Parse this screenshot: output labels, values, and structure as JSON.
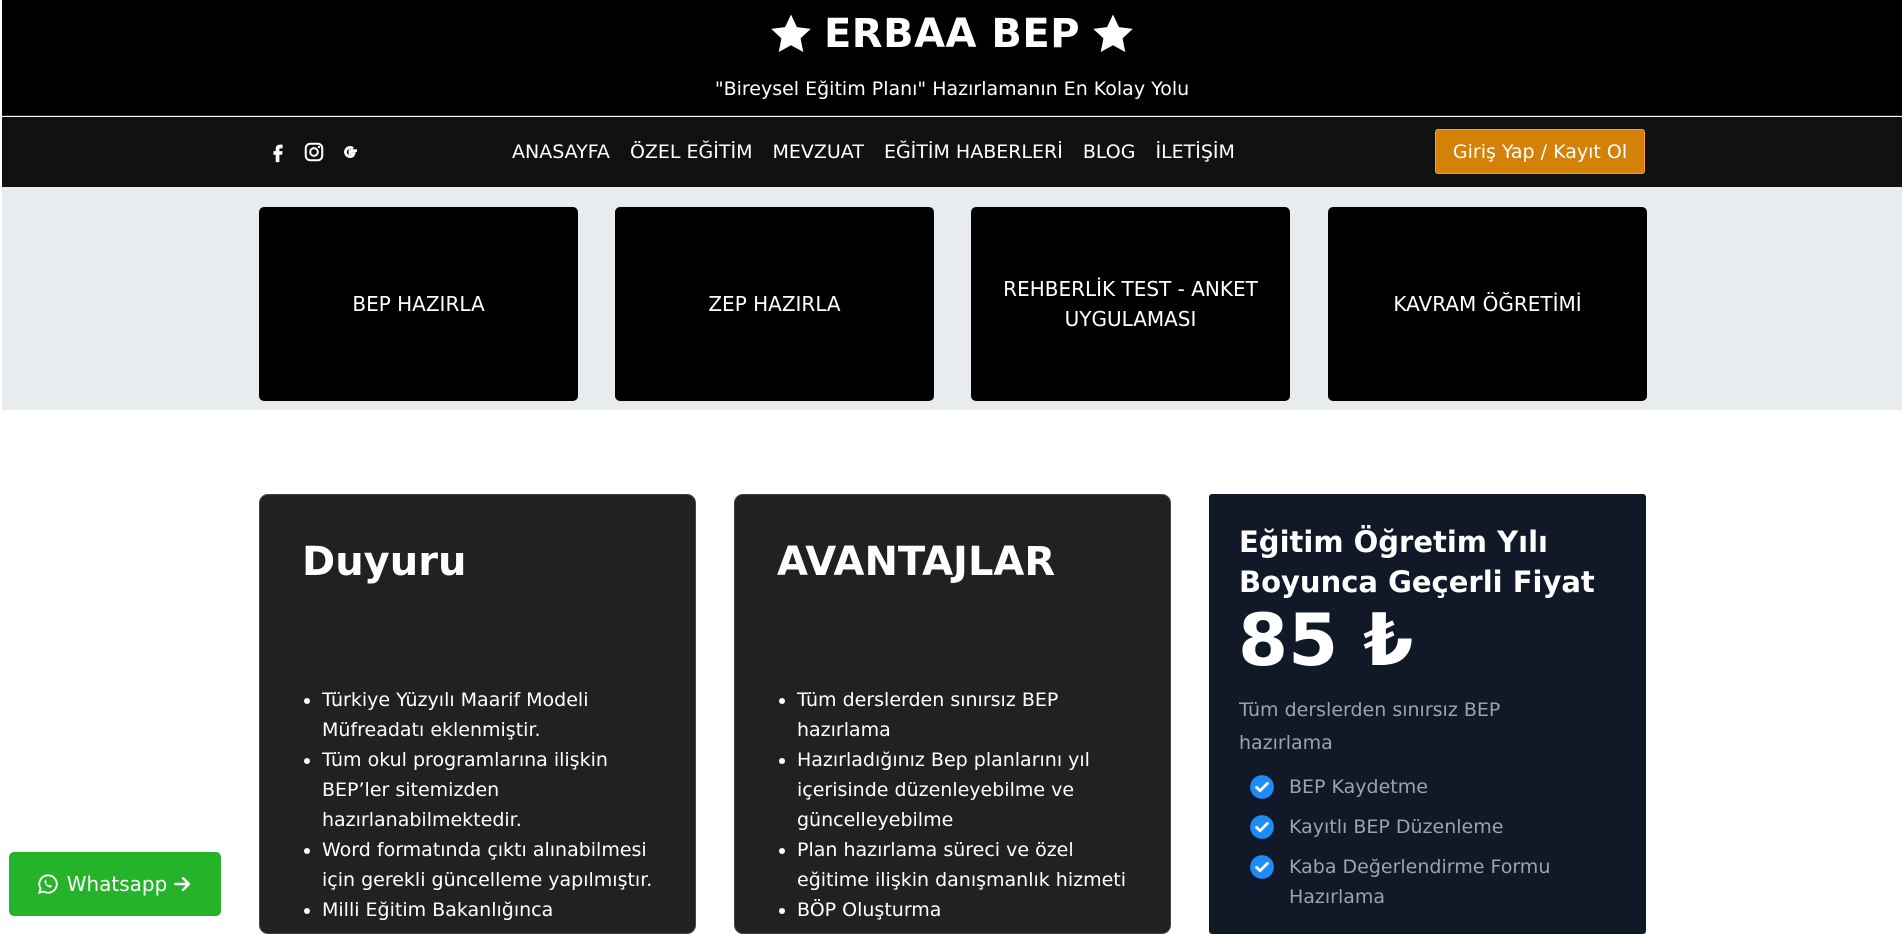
{
  "header": {
    "brand": "ERBAA BEP",
    "tagline": "\"Bireysel Eğitim Planı\" Hazırlamanın En Kolay Yolu"
  },
  "socials": [
    {
      "icon": "facebook-icon"
    },
    {
      "icon": "instagram-icon"
    },
    {
      "icon": "google-icon"
    }
  ],
  "nav": {
    "links": [
      "ANASAYFA",
      "ÖZEL EĞİTİM",
      "MEVZUAT",
      "EĞİTİM HABERLERİ",
      "BLOG",
      "İLETİŞİM"
    ],
    "login_label": "Giriş Yap / Kayıt Ol"
  },
  "tiles": [
    "BEP HAZIRLA",
    "ZEP HAZIRLA",
    "REHBERLİK TEST - ANKET UYGULAMASI",
    "KAVRAM ÖĞRETİMİ"
  ],
  "announcement": {
    "title": "Duyuru",
    "items": [
      "Türkiye Yüzyılı Maarif Modeli Müfreadatı eklenmiştir.",
      "Tüm okul programlarına ilişkin BEP’ler sitemizden hazırlanabilmektedir.",
      "Word formatında çıktı alınabilmesi için gerekli güncelleme yapılmıştır.",
      "Milli Eğitim Bakanlığınca"
    ]
  },
  "advantages": {
    "title": "AVANTAJLAR",
    "items": [
      "Tüm derslerden sınırsız BEP hazırlama",
      "Hazırladığınız Bep planlarını yıl içerisinde düzenleyebilme ve güncelleyebilme",
      "Plan hazırlama süreci ve özel eğitime ilişkin danışmanlık hizmeti",
      "BÖP Oluşturma"
    ]
  },
  "pricing": {
    "heading": "Eğitim Öğretim Yılı Boyunca Geçerli Fiyat",
    "price": "85 ₺",
    "description": "Tüm derslerden sınırsız BEP hazırlama",
    "features": [
      "BEP Kaydetme",
      "Kayıtlı BEP Düzenleme",
      "Kaba Değerlendirme Formu Hazırlama"
    ]
  },
  "whatsapp": {
    "label": "Whatsapp"
  },
  "colors": {
    "header_bg": "#000000",
    "accent_orange": "#d4810a",
    "price_card_bg": "#111827",
    "check_blue": "#1d8cf8",
    "whatsapp_green": "#25b32a"
  }
}
